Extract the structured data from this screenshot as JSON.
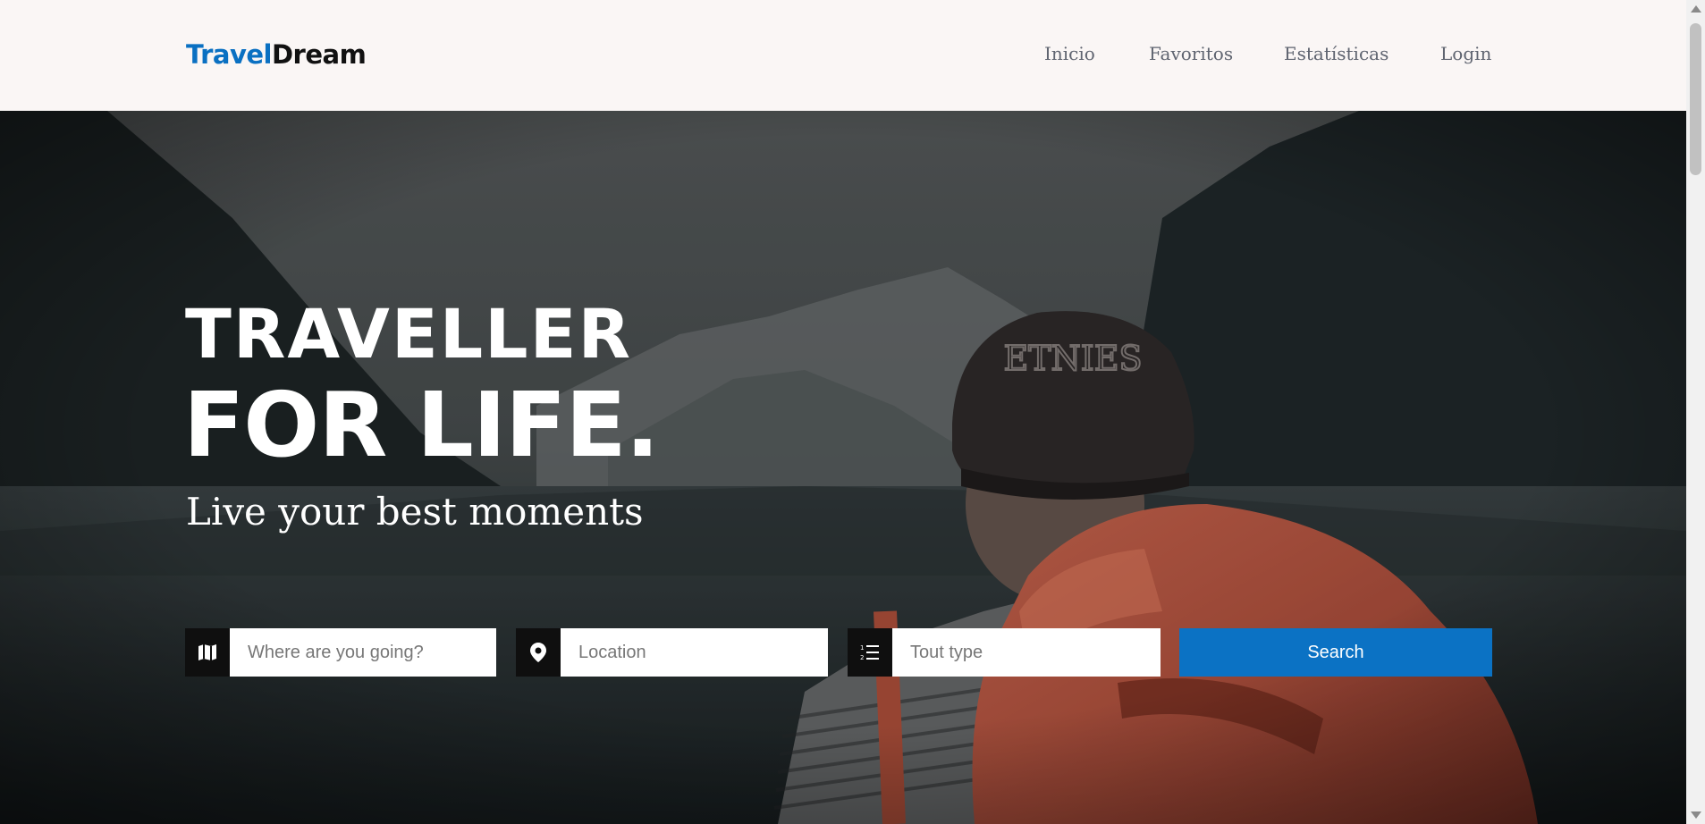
{
  "brand": {
    "part1": "Travel",
    "part2": "Dream",
    "color_primary": "#0a70c2",
    "color_secondary": "#111111"
  },
  "nav": {
    "items": [
      {
        "label": "Inicio"
      },
      {
        "label": "Favoritos"
      },
      {
        "label": "Estatísticas"
      },
      {
        "label": "Login"
      }
    ]
  },
  "hero": {
    "title_line1": "TRAVELLER",
    "title_line2": "FOR LIFE.",
    "subtitle": "Live your best moments"
  },
  "search": {
    "destination": {
      "placeholder": "Where are you going?",
      "icon": "map-icon"
    },
    "location": {
      "placeholder": "Location",
      "icon": "map-pin-icon"
    },
    "tour_type": {
      "placeholder": "Tout type",
      "icon": "list-ordered-icon"
    },
    "button_label": "Search",
    "button_color": "#0b72c4"
  }
}
